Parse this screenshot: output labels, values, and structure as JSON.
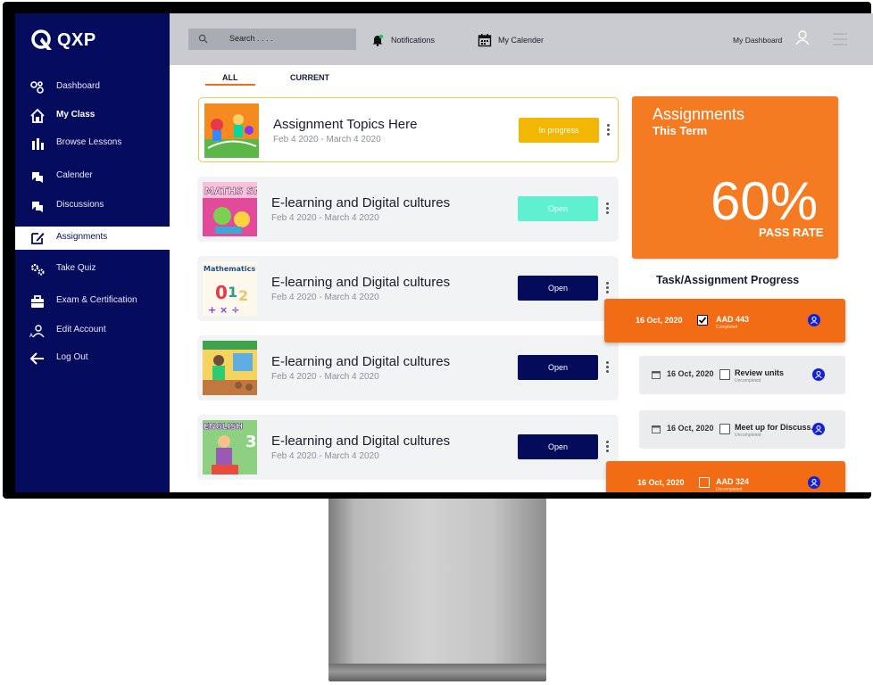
{
  "app": {
    "logo_text": "QXP"
  },
  "sidebar": {
    "items": [
      {
        "label": "Dashboard"
      },
      {
        "label": "My Class"
      },
      {
        "label": "Browse Lessons"
      },
      {
        "label": "Calender"
      },
      {
        "label": "Discussions"
      },
      {
        "label": "Assignments"
      },
      {
        "label": "Take Quiz"
      },
      {
        "label": "Exam & Certification"
      },
      {
        "label": "Edit Account"
      },
      {
        "label": "Log Out"
      }
    ]
  },
  "header": {
    "search_placeholder": "Search . . . .",
    "notifications_label": "Notifications",
    "calendar_label": "My Calender",
    "dashboard_label": "My Dashboard"
  },
  "tabs": [
    {
      "label": "ALL"
    },
    {
      "label": "CURRENT"
    }
  ],
  "assignments": [
    {
      "title": "Assignment Topics Here",
      "dates": "Feb 4 2020 - March 4 2020",
      "status": "In progress",
      "status_color": "#f2b705"
    },
    {
      "title": "E-learning and Digital cultures",
      "dates": "Feb 4 2020 - March 4 2020",
      "status": "Open",
      "status_color": "#5ff0cf"
    },
    {
      "title": "E-learning and Digital cultures",
      "dates": "Feb 4 2020 - March 4 2020",
      "status": "Open",
      "status_color": "#040b5a"
    },
    {
      "title": "E-learning and Digital cultures",
      "dates": "Feb 4 2020 - March 4 2020",
      "status": "Open",
      "status_color": "#040b5a"
    },
    {
      "title": "E-learning and Digital cultures",
      "dates": "Feb 4 2020 - March 4 2020",
      "status": "Open",
      "status_color": "#040b5a"
    }
  ],
  "thumb_texts": {
    "maths": "MATHS SMAR",
    "mathematics": "Mathematics",
    "english": "ENGLISH"
  },
  "summary": {
    "title": "Assignments",
    "subtitle": "This Term",
    "pass_rate": "60%",
    "pass_rate_label": "PASS RATE",
    "color": "#f47b22"
  },
  "progress": {
    "heading": "Task/Assignment Progress",
    "tasks": [
      {
        "date": "16 Oct, 2020",
        "name": "AAD 443",
        "status": "Completed",
        "checked": true
      },
      {
        "date": "16 Oct, 2020",
        "name": "Review units",
        "status": "Uncompleted",
        "checked": false
      },
      {
        "date": "16 Oct, 2020",
        "name": "Meet up for Discuss.",
        "status": "Uncompleted",
        "checked": false
      },
      {
        "date": "16 Oct, 2020",
        "name": "AAD 324",
        "status": "Uncompleted",
        "checked": false
      }
    ]
  },
  "colors": {
    "sidebar": "#050c5e",
    "accent": "#f26b15",
    "header": "#c9cbce"
  }
}
